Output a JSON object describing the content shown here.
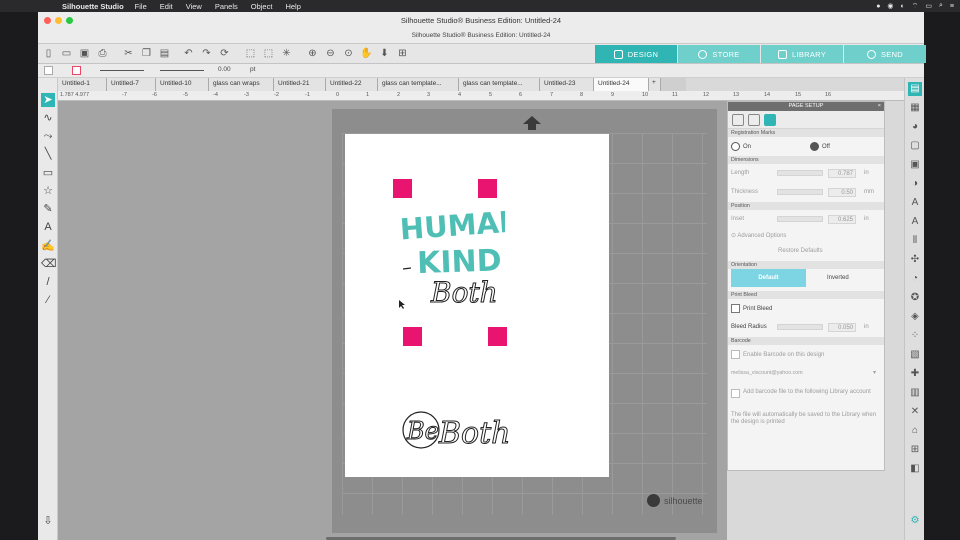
{
  "menubar": {
    "apple": "",
    "app_name": "Silhouette Studio",
    "items": [
      "File",
      "Edit",
      "View",
      "Panels",
      "Object",
      "Help"
    ]
  },
  "window": {
    "title": "Silhouette Studio® Business Edition: Untitled-24",
    "subtitle": "Silhouette Studio® Business Edition: Untitled-24"
  },
  "nav_tabs": [
    "DESIGN",
    "STORE",
    "LIBRARY",
    "SEND"
  ],
  "props": {
    "line_width": "0.00",
    "unit": "pt"
  },
  "doc_tabs": [
    "Untitled-1",
    "Untitled-7",
    "Untitled-10",
    "glass can wraps",
    "Untitled-21",
    "Untitled-22",
    "glass can template...",
    "glass can template...",
    "Untitled-23",
    "Untitled-24",
    "+"
  ],
  "ruler": {
    "coords": "1.787 4.977",
    "ticks": [
      "-7",
      "-6",
      "-5",
      "-4",
      "-3",
      "-2",
      "-1",
      "0",
      "1",
      "2",
      "3",
      "4",
      "5",
      "6",
      "7",
      "8",
      "9",
      "10",
      "11",
      "12",
      "13",
      "14",
      "15",
      "16"
    ]
  },
  "brand": "silhouette",
  "design_text": {
    "line1": "HUMAN",
    "line2": "KIND",
    "line3": "Both",
    "line4": "Be",
    "line5": "Both"
  },
  "panel": {
    "title": "PAGE SETUP",
    "close": "×",
    "registration_header": "Registration Marks",
    "on_label": "On",
    "off_label": "Off",
    "dimensions_header": "Dimensions",
    "length_label": "Length",
    "length_value": "0.787",
    "thickness_label": "Thickness",
    "thickness_value": "0.50",
    "length_unit": "in",
    "thickness_unit": "mm",
    "position_header": "Position",
    "inset_label": "Inset",
    "inset_value": "0.625",
    "inset_unit": "in",
    "advanced_label": "Advanced Options",
    "restore_label": "Restore Defaults",
    "orientation_header": "Orientation",
    "default_label": "Default",
    "inverted_label": "Inverted",
    "print_bleed_header": "Print Bleed",
    "print_bleed_label": "Print Bleed",
    "bleed_radius_label": "Bleed Radius",
    "bleed_radius_value": "0.050",
    "bleed_radius_unit": "in",
    "barcode_header": "Barcode",
    "barcode_enable_label": "Enable Barcode on this design",
    "account_email": "melissa_viscount@yahoo.com",
    "add_barcode_label": "Add barcode file to the following Library account",
    "note": "The file will automatically be saved to the Library when the design is printed"
  },
  "colors": {
    "accent": "#2fb5b3",
    "registration": "#e8146f",
    "teal_text": "#4fbfb6"
  }
}
